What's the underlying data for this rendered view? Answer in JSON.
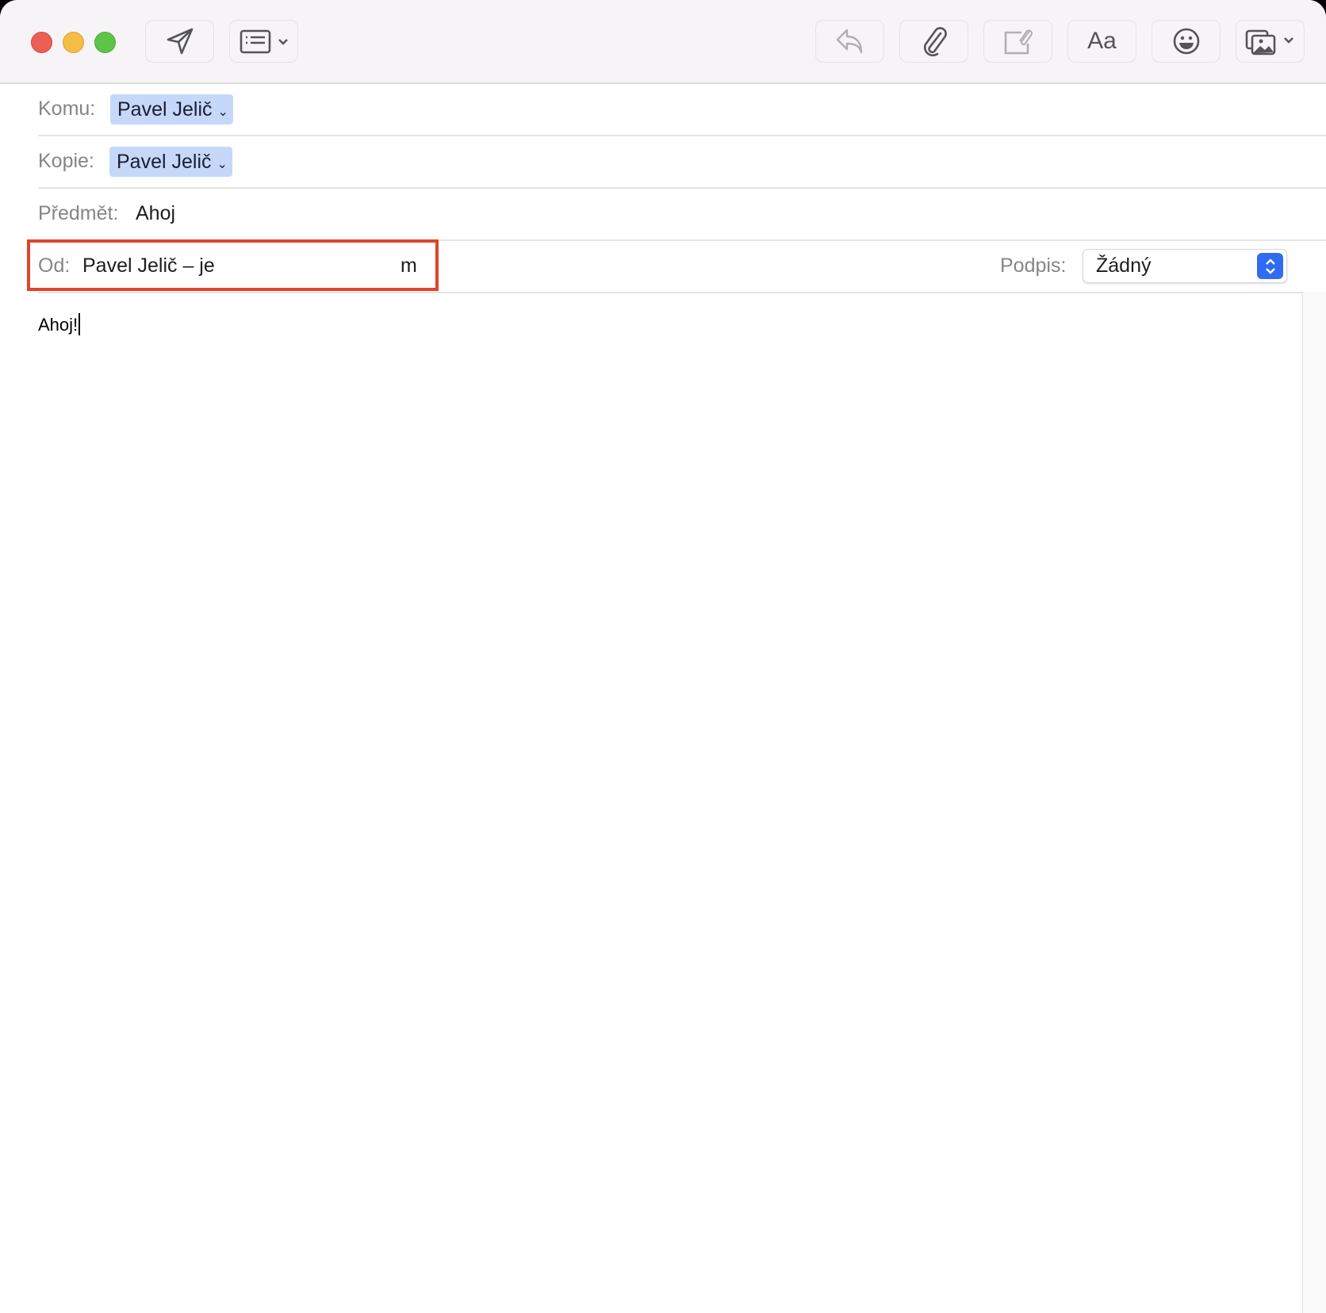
{
  "toolbar": {
    "buttons": [
      "send-icon",
      "header-fields-icon",
      "reply-icon",
      "attachment-icon",
      "markup-attachment-icon",
      "format-text",
      "emoji-icon",
      "photo-browser-icon"
    ],
    "format_label": "Aa"
  },
  "fields": {
    "to_label": "Komu:",
    "to_value": "Pavel Jelič",
    "cc_label": "Kopie:",
    "cc_value": "Pavel Jelič",
    "subject_label": "Předmět:",
    "subject_value": "Ahoj",
    "from_label": "Od:",
    "from_value_start": "Pavel Jelič – je",
    "from_value_end": "m",
    "signature_label": "Podpis:",
    "signature_value": "Žádný"
  },
  "body": {
    "text": "Ahoj!"
  },
  "colors": {
    "highlight": "#e0442c",
    "pill": "#c6d8fa",
    "accent": "#2f6cf2"
  }
}
